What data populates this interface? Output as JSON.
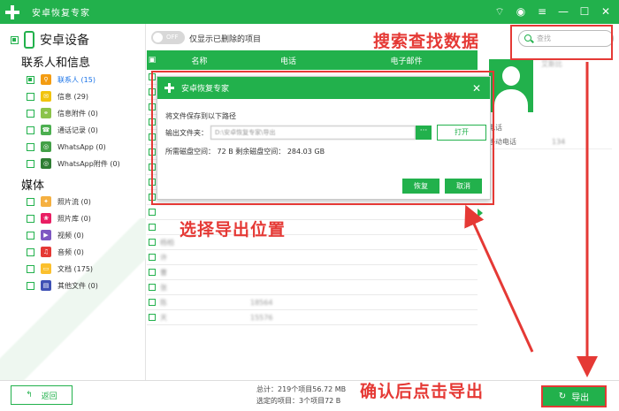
{
  "app": {
    "title": "安卓恢复专家"
  },
  "window_controls": [
    "wifi-icon",
    "chat-icon",
    "menu-icon",
    "minimize-icon",
    "maximize-icon",
    "close-icon"
  ],
  "sidebar": {
    "device": "安卓设备",
    "sections": [
      {
        "title": "联系人和信息",
        "items": [
          {
            "label": "联系人 (15)",
            "icon": "contact-icon",
            "color": "#f39c12",
            "checked": true,
            "selected": true
          },
          {
            "label": "信息 (29)",
            "icon": "message-icon",
            "color": "#f1c40f",
            "checked": false
          },
          {
            "label": "信息附件 (0)",
            "icon": "attachment-icon",
            "color": "#8bc34a",
            "checked": false
          },
          {
            "label": "通话记录 (0)",
            "icon": "call-icon",
            "color": "#4caf50",
            "checked": false
          },
          {
            "label": "WhatsApp (0)",
            "icon": "whatsapp-icon",
            "color": "#43a047",
            "checked": false
          },
          {
            "label": "WhatsApp附件 (0)",
            "icon": "whatsapp-attachment-icon",
            "color": "#2e7d32",
            "checked": false
          }
        ]
      },
      {
        "title": "媒体",
        "items": [
          {
            "label": "照片流 (0)",
            "icon": "photo-stream-icon",
            "color": "#f5b041",
            "checked": false
          },
          {
            "label": "照片库 (0)",
            "icon": "photo-library-icon",
            "color": "#e91e63",
            "checked": false
          },
          {
            "label": "视频 (0)",
            "icon": "video-icon",
            "color": "#7e57c2",
            "checked": false
          },
          {
            "label": "音频 (0)",
            "icon": "audio-icon",
            "color": "#e53935",
            "checked": false
          },
          {
            "label": "文档 (175)",
            "icon": "document-icon",
            "color": "#fbc02d",
            "checked": false
          },
          {
            "label": "其他文件 (0)",
            "icon": "other-files-icon",
            "color": "#3f51b5",
            "checked": false
          }
        ]
      }
    ]
  },
  "filter": {
    "toggle": "OFF",
    "label": "仅显示已删除的项目",
    "search_placeholder": "查找"
  },
  "table": {
    "headers": [
      "名称",
      "电话",
      "电子邮件"
    ],
    "rows": [
      {
        "name": "",
        "phone": ""
      },
      {
        "name": "",
        "phone": ""
      },
      {
        "name": "",
        "phone": ""
      },
      {
        "name": "",
        "phone": ""
      },
      {
        "name": "",
        "phone": ""
      },
      {
        "name": "",
        "phone": ""
      },
      {
        "name": "",
        "phone": ""
      },
      {
        "name": "",
        "phone": ""
      },
      {
        "name": "",
        "phone": ""
      },
      {
        "name": "",
        "phone": ""
      },
      {
        "name": "",
        "phone": ""
      },
      {
        "name": "杨柏",
        "phone": ""
      },
      {
        "name": "许",
        "phone": ""
      },
      {
        "name": "曹",
        "phone": ""
      },
      {
        "name": "张",
        "phone": ""
      },
      {
        "name": "陈",
        "phone": "18564"
      },
      {
        "name": "天",
        "phone": "15576"
      }
    ]
  },
  "detail": {
    "name": "艾斯比",
    "section": "电话",
    "row_label": "移动电话",
    "row_value": "134"
  },
  "dialog": {
    "title": "安卓恢复专家",
    "prompt": "将文件保存到以下路径",
    "folder_label": "输出文件夹：",
    "folder_value": "D:\\安卓恢复专家\\导出",
    "browse_label": "···",
    "open_label": "打开",
    "space": "所需磁盘空间： 72 B  剩余磁盘空间： 284.03 GB",
    "restore_label": "恢复",
    "cancel_label": "取消"
  },
  "footer": {
    "back_label": "返回",
    "total": "总计：219个项目56.72 MB",
    "selected": "选定的项目：3个项目72 B",
    "export_label": "导出"
  },
  "annotations": {
    "search": "搜索查找数据",
    "choose": "选择导出位置",
    "confirm": "确认后点击导出"
  },
  "colors": {
    "accent": "#22b14c",
    "annotation": "#e53935"
  }
}
